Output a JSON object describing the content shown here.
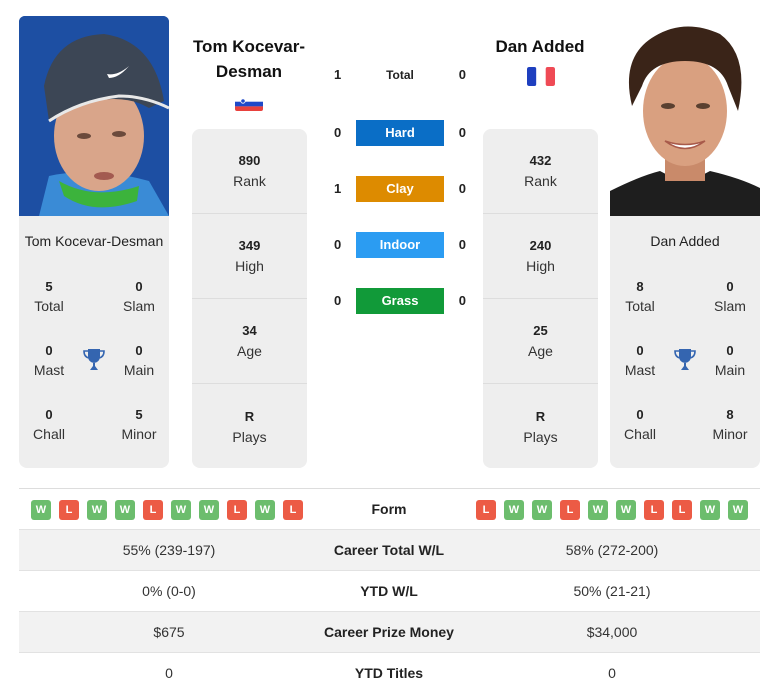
{
  "colors": {
    "hard": "#0a6ec6",
    "clay": "#dd8b00",
    "indoor": "#2b9cf2",
    "grass": "#119a39",
    "win": "#6cbd6d",
    "loss": "#ec5b45",
    "trophy": "#3465b0"
  },
  "player1": {
    "name": "Tom Kocevar-Desman",
    "header_name": "Tom Kocevar-Desman",
    "flag": "slovenia-flag",
    "photo": "player-photo-blue-cap",
    "stats": [
      {
        "value": "890",
        "label": "Rank"
      },
      {
        "value": "349",
        "label": "High"
      },
      {
        "value": "34",
        "label": "Age"
      },
      {
        "value": "R",
        "label": "Plays"
      }
    ],
    "titles": {
      "total": {
        "value": "5",
        "label": "Total"
      },
      "slam": {
        "value": "0",
        "label": "Slam"
      },
      "mast": {
        "value": "0",
        "label": "Mast"
      },
      "main": {
        "value": "0",
        "label": "Main"
      },
      "chall": {
        "value": "0",
        "label": "Chall"
      },
      "minor": {
        "value": "5",
        "label": "Minor"
      }
    },
    "form": [
      "W",
      "L",
      "W",
      "W",
      "L",
      "W",
      "W",
      "L",
      "W",
      "L"
    ]
  },
  "player2": {
    "name": "Dan Added",
    "header_name": "Dan Added",
    "flag": "france-flag",
    "photo": "player-photo-smiling",
    "stats": [
      {
        "value": "432",
        "label": "Rank"
      },
      {
        "value": "240",
        "label": "High"
      },
      {
        "value": "25",
        "label": "Age"
      },
      {
        "value": "R",
        "label": "Plays"
      }
    ],
    "titles": {
      "total": {
        "value": "8",
        "label": "Total"
      },
      "slam": {
        "value": "0",
        "label": "Slam"
      },
      "mast": {
        "value": "0",
        "label": "Mast"
      },
      "main": {
        "value": "0",
        "label": "Main"
      },
      "chall": {
        "value": "0",
        "label": "Chall"
      },
      "minor": {
        "value": "8",
        "label": "Minor"
      }
    },
    "form": [
      "L",
      "W",
      "W",
      "L",
      "W",
      "W",
      "L",
      "L",
      "W",
      "W"
    ]
  },
  "h2h": [
    {
      "label": "Total",
      "left": "1",
      "right": "0",
      "surface": "total"
    },
    {
      "label": "Hard",
      "left": "0",
      "right": "0",
      "surface": "hard"
    },
    {
      "label": "Clay",
      "left": "1",
      "right": "0",
      "surface": "clay"
    },
    {
      "label": "Indoor",
      "left": "0",
      "right": "0",
      "surface": "indoor"
    },
    {
      "label": "Grass",
      "left": "0",
      "right": "0",
      "surface": "grass"
    }
  ],
  "comparison": {
    "form_label": "Form",
    "rows": [
      {
        "label": "Career Total W/L",
        "left": "55% (239-197)",
        "right": "58% (272-200)"
      },
      {
        "label": "YTD W/L",
        "left": "0% (0-0)",
        "right": "50% (21-21)"
      },
      {
        "label": "Career Prize Money",
        "left": "$675",
        "right": "$34,000"
      },
      {
        "label": "YTD Titles",
        "left": "0",
        "right": "0"
      }
    ]
  }
}
